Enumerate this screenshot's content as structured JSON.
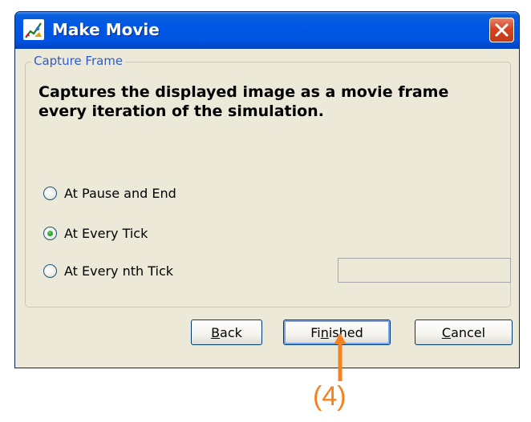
{
  "window": {
    "title": "Make Movie",
    "app_icon": "movie-app-icon",
    "close_icon": "close-icon"
  },
  "group": {
    "legend": "Capture Frame",
    "description_line1": "Captures the displayed image as a movie frame",
    "description_line2": "every iteration of the simulation."
  },
  "options": [
    {
      "label": "At Pause and End",
      "selected": false
    },
    {
      "label": "At Every Tick",
      "selected": true
    },
    {
      "label": "At Every nth Tick",
      "selected": false
    }
  ],
  "nth_tick_value": "",
  "buttons": {
    "back_mnemonic": "B",
    "back_rest": "ack",
    "finished_pre": "Fi",
    "finished_mnemonic": "n",
    "finished_rest": "ished",
    "cancel_mnemonic": "C",
    "cancel_rest": "ancel"
  },
  "annotation": {
    "label": "(4)",
    "color": "#f58220"
  },
  "colors": {
    "titlebar": "#0058e6",
    "dialog_bg": "#ece9d8",
    "legend_text": "#2e5ccf",
    "close_button": "#d8431f"
  }
}
